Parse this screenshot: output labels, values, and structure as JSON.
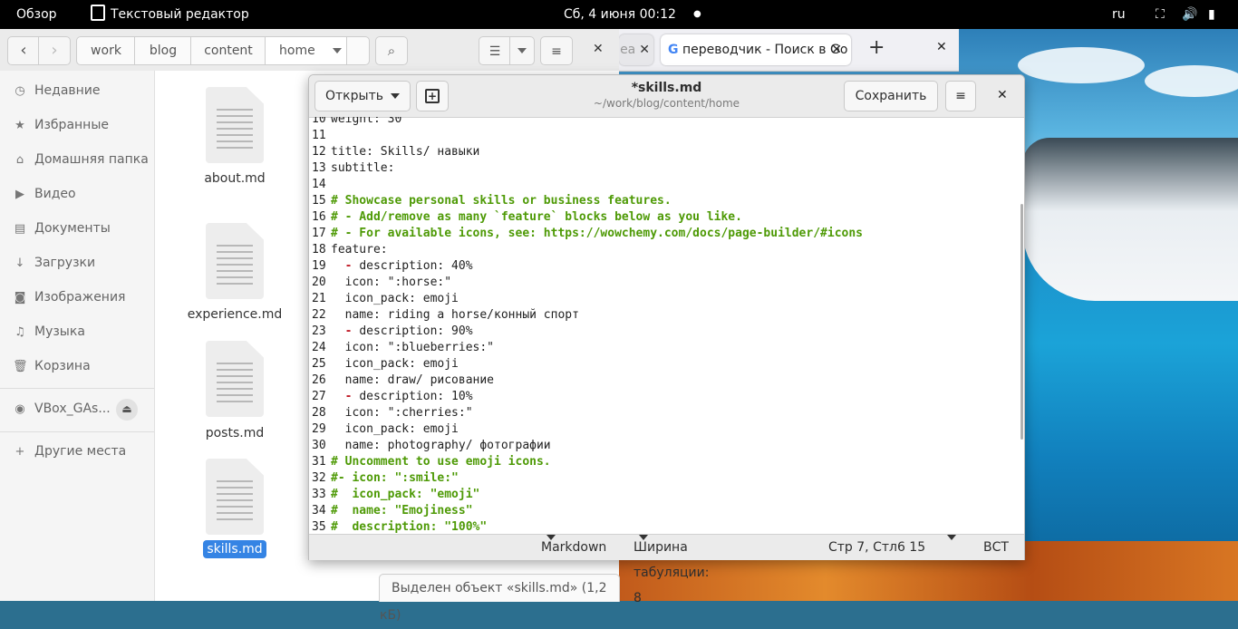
{
  "topbar": {
    "activities": "Обзор",
    "app_name": "Текстовый редактор",
    "clock": "Сб, 4 июня  00:12",
    "lang": "ru"
  },
  "file_manager": {
    "breadcrumbs": [
      "work",
      "blog",
      "content",
      "home"
    ],
    "sidebar": [
      {
        "icon": "clock-icon",
        "label": "Недавние"
      },
      {
        "icon": "star-icon",
        "label": "Избранные"
      },
      {
        "icon": "home-icon",
        "label": "Домашняя папка"
      },
      {
        "icon": "video-icon",
        "label": "Видео"
      },
      {
        "icon": "document-icon",
        "label": "Документы"
      },
      {
        "icon": "download-icon",
        "label": "Загрузки"
      },
      {
        "icon": "camera-icon",
        "label": "Изображения"
      },
      {
        "icon": "music-icon",
        "label": "Музыка"
      },
      {
        "icon": "trash-icon",
        "label": "Корзина"
      },
      {
        "icon": "disc-icon",
        "label": "VBox_GAs..."
      },
      {
        "icon": "plus-icon",
        "label": "Другие места"
      }
    ],
    "files": [
      "about.md",
      "experience.md",
      "posts.md",
      "skills.md"
    ],
    "status": "Выделен объект «skills.md» (1,2 кБ)"
  },
  "browser": {
    "tab_partial": "ea",
    "tab_title": "переводчик - Поиск в Go"
  },
  "editor": {
    "open_label": "Открыть",
    "title": "*skills.md",
    "path": "~/work/blog/content/home",
    "save_label": "Сохранить",
    "lines": [
      {
        "n": "10",
        "t": "weight: 30",
        "k": "plain"
      },
      {
        "n": "11",
        "t": "",
        "k": "plain"
      },
      {
        "n": "12",
        "t": "title: Skills/ навыки",
        "k": "plain"
      },
      {
        "n": "13",
        "t": "subtitle:",
        "k": "plain"
      },
      {
        "n": "14",
        "t": "",
        "k": "plain"
      },
      {
        "n": "15",
        "t": "# Showcase personal skills or business features.",
        "k": "comment"
      },
      {
        "n": "16",
        "t": "# - Add/remove as many `feature` blocks below as you like.",
        "k": "comment"
      },
      {
        "n": "17",
        "t": "# - For available icons, see: https://wowchemy.com/docs/page-builder/#icons",
        "k": "comment"
      },
      {
        "n": "18",
        "t": "feature:",
        "k": "plain"
      },
      {
        "n": "19",
        "t": "description: 40%",
        "k": "item"
      },
      {
        "n": "20",
        "t": "  icon: \":horse:\"",
        "k": "plain"
      },
      {
        "n": "21",
        "t": "  icon_pack: emoji",
        "k": "plain"
      },
      {
        "n": "22",
        "t": "  name: riding a horse/конный спорт",
        "k": "plain"
      },
      {
        "n": "23",
        "t": "description: 90%",
        "k": "item"
      },
      {
        "n": "24",
        "t": "  icon: \":blueberries:\"",
        "k": "plain"
      },
      {
        "n": "25",
        "t": "  icon_pack: emoji",
        "k": "plain"
      },
      {
        "n": "26",
        "t": "  name: draw/ рисование",
        "k": "plain"
      },
      {
        "n": "27",
        "t": "description: 10%",
        "k": "item"
      },
      {
        "n": "28",
        "t": "  icon: \":cherries:\"",
        "k": "plain"
      },
      {
        "n": "29",
        "t": "  icon_pack: emoji",
        "k": "plain"
      },
      {
        "n": "30",
        "t": "  name: photography/ фотографии",
        "k": "plain"
      },
      {
        "n": "31",
        "t": "# Uncomment to use emoji icons.",
        "k": "comment"
      },
      {
        "n": "32",
        "t": "#- icon: \":smile:\"",
        "k": "comment"
      },
      {
        "n": "33",
        "t": "#  icon_pack: \"emoji\"",
        "k": "comment"
      },
      {
        "n": "34",
        "t": "#  name: \"Emojiness\"",
        "k": "comment"
      },
      {
        "n": "35",
        "t": "#  description: \"100%\"",
        "k": "comment"
      }
    ],
    "status": {
      "language": "Markdown",
      "tab_width": "Ширина табуляции: 8",
      "position": "Стр 7, Стл6 15",
      "mode": "ВСТ"
    }
  }
}
